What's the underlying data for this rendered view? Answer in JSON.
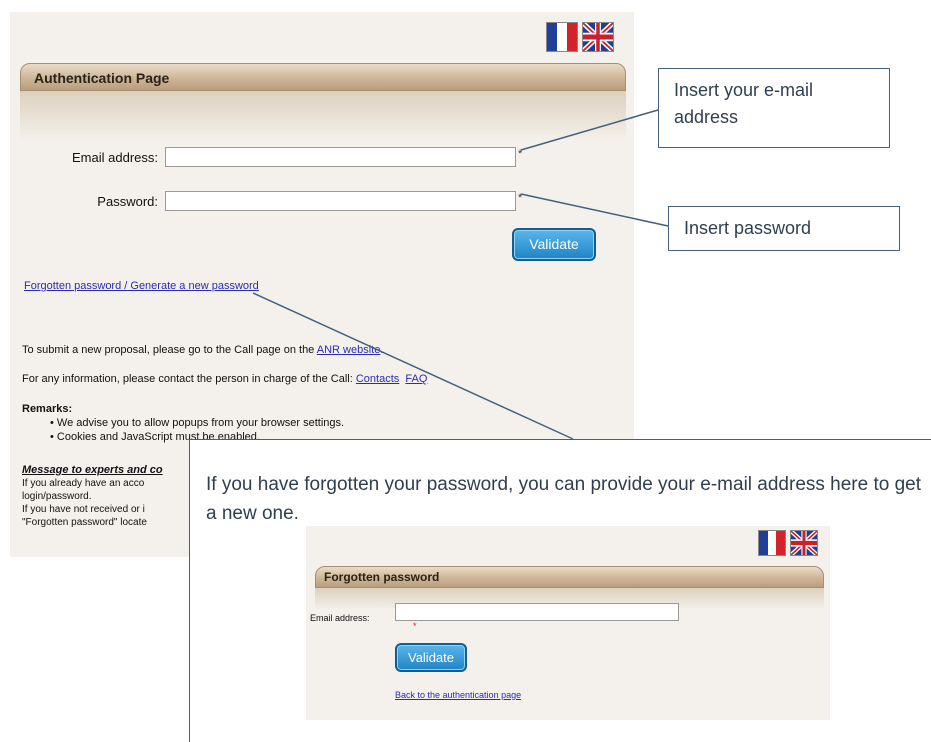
{
  "auth_page": {
    "title": "Authentication Page",
    "email_label": "Email address:",
    "password_label": "Password:",
    "required_mark": "*",
    "validate_label": "Validate",
    "forgot_link": "Forgotten password / Generate a new password",
    "submit_prefix": "To submit a new proposal, please go to the Call page on the",
    "anr_link": "ANR website",
    "submit_suffix": ".",
    "info_prefix": "For any information, please contact the person in charge of the Call:",
    "contacts_link": "Contacts",
    "faq_link": "FAQ",
    "remarks_title": "Remarks:",
    "remarks": [
      "We advise you to allow popups from your browser settings.",
      "Cookies and JavaScript must be enabled."
    ],
    "message_title": "Message to experts and co",
    "message_lines": [
      "If you already have an acco",
      "login/password.",
      "If you have not received or i",
      "\"Forgotten password\" locate"
    ]
  },
  "callouts": {
    "email": "Insert your e-mail address",
    "password": "Insert password",
    "forgot": "If you have forgotten your password, you can provide your e-mail address here to get a new one."
  },
  "forgot_page": {
    "title": "Forgotten password",
    "email_label": "Email address:",
    "required_mark": "*",
    "validate_label": "Validate",
    "back_link": "Back to the authentication page"
  },
  "colors": {
    "header_gradient": "#cdb597",
    "panel_bg": "#f4f1ec",
    "button_blue": "#1f84c6",
    "link_blue": "#2a2ab8",
    "callout_border": "#44607d",
    "callout_text": "#2f3f52"
  }
}
